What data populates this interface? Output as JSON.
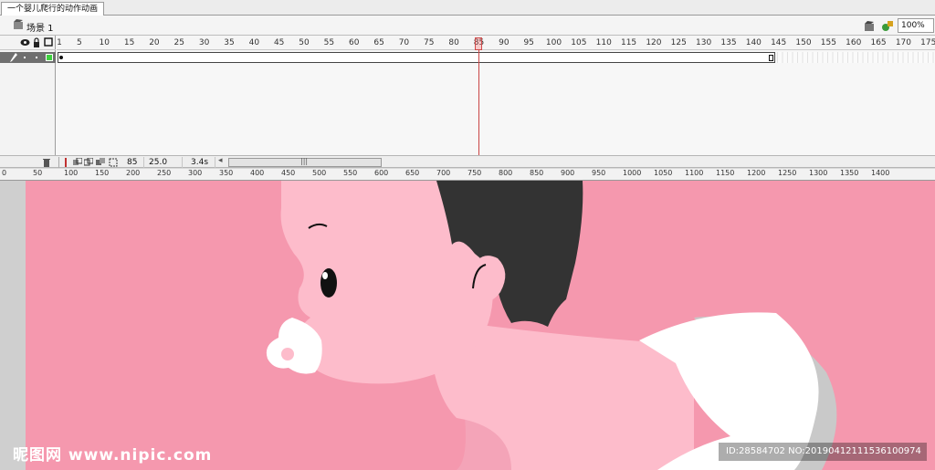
{
  "document": {
    "tab_title": "一个婴儿爬行的动作动画"
  },
  "scene": {
    "label": "场景 1",
    "zoom": "100%"
  },
  "timeline": {
    "frame_numbers": [
      "1",
      "5",
      "10",
      "15",
      "20",
      "25",
      "30",
      "35",
      "40",
      "45",
      "50",
      "55",
      "60",
      "65",
      "70",
      "75",
      "80",
      "85",
      "90",
      "95",
      "100",
      "105",
      "110",
      "115",
      "120",
      "125",
      "130",
      "135",
      "140",
      "145",
      "150",
      "155",
      "160",
      "165",
      "170",
      "175"
    ],
    "current_frame": 85,
    "last_tween_frame": 143
  },
  "status": {
    "frame": "85",
    "fps": "25.0 fps",
    "time": "3.4s"
  },
  "stage_ruler": {
    "labels": [
      "0",
      "50",
      "100",
      "150",
      "200",
      "250",
      "300",
      "350",
      "400",
      "450",
      "500",
      "550",
      "600",
      "650",
      "700",
      "750",
      "800",
      "850",
      "900",
      "950",
      "1000",
      "1050",
      "1100",
      "1150",
      "1200",
      "1250",
      "1300",
      "1350",
      "1400"
    ]
  },
  "watermark": {
    "logo_text": "昵图网 www.nipic.com",
    "id_text": "ID:28584702 NO:20190412111536100974"
  },
  "colors": {
    "stage_bg": "#f598ae",
    "skin": "#fdbccb",
    "hair": "#333333",
    "diaper": "#ffffff",
    "diaper_shadow": "#c9c9c9"
  },
  "icons": [
    "scene-icon",
    "edit-scene-icon",
    "edit-symbol-icon",
    "eye-icon",
    "lock-icon",
    "outline-icon",
    "pencil-icon",
    "trash-icon",
    "onion-skin-icon"
  ]
}
